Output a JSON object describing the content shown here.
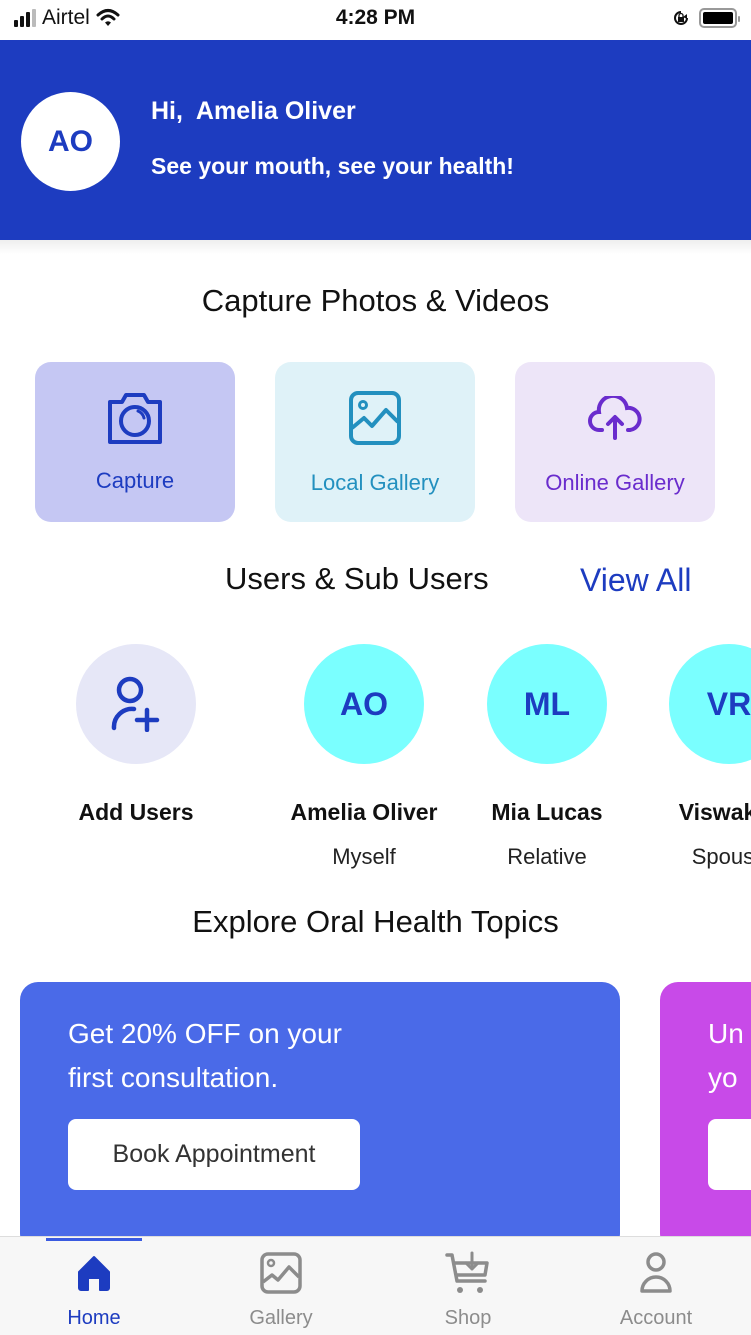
{
  "status_bar": {
    "carrier": "Airtel",
    "time": "4:28 PM",
    "icons": [
      "signal-icon",
      "wifi-icon",
      "orientation-lock-icon",
      "battery-icon"
    ]
  },
  "header": {
    "avatar_initials": "AO",
    "greeting": "Hi,  Amelia Oliver",
    "tagline": "See your mouth, see your health!",
    "background_color": "#1d3cc0"
  },
  "capture_section": {
    "title": "Capture Photos & Videos",
    "tiles": [
      {
        "label": "Capture",
        "icon": "camera-icon",
        "bg": "#c5c7f3",
        "color": "#1d3cc0"
      },
      {
        "label": "Local Gallery",
        "icon": "image-icon",
        "bg": "#dff2f8",
        "color": "#2390bf"
      },
      {
        "label": "Online Gallery",
        "icon": "cloud-upload-icon",
        "bg": "#ede5f8",
        "color": "#6a2ccd"
      }
    ]
  },
  "users_section": {
    "title": "Users & Sub Users",
    "view_all": "View All",
    "add_user": {
      "label": "Add Users",
      "icon": "add-user-icon"
    },
    "users": [
      {
        "initials": "AO",
        "name": "Amelia Oliver",
        "relation": "Myself"
      },
      {
        "initials": "ML",
        "name": "Mia Lucas",
        "relation": "Relative"
      },
      {
        "initials": "VR",
        "name": "Viswak R",
        "relation": "Spouse"
      }
    ]
  },
  "topics_section": {
    "title": "Explore Oral Health Topics",
    "cards": [
      {
        "text_line1": "Get 20% OFF on your",
        "text_line2": "first consultation.",
        "button": "Book Appointment",
        "bg": "#4a6ae8"
      },
      {
        "text_line1": "Un",
        "text_line2": "yo",
        "button": "",
        "bg": "#c84ae8"
      }
    ]
  },
  "bottom_nav": {
    "items": [
      {
        "label": "Home",
        "icon": "home-icon",
        "active": true
      },
      {
        "label": "Gallery",
        "icon": "gallery-icon",
        "active": false
      },
      {
        "label": "Shop",
        "icon": "cart-icon",
        "active": false
      },
      {
        "label": "Account",
        "icon": "account-icon",
        "active": false
      }
    ],
    "active_color": "#1d3cc0",
    "inactive_color": "#8c8c8c"
  }
}
